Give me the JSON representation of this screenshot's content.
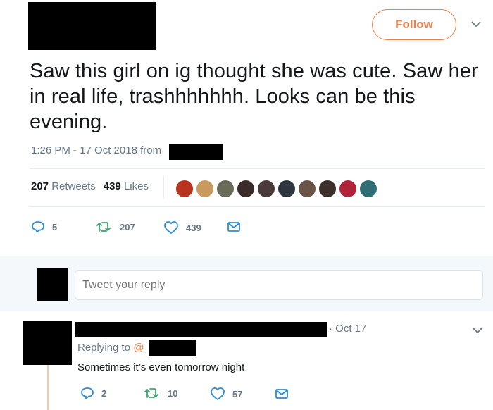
{
  "colors": {
    "accent": "#e8824a",
    "muted": "#657786",
    "text": "#14171a"
  },
  "header": {
    "follow_label": "Follow",
    "caret_icon": "chevron-down-icon"
  },
  "tweet": {
    "text": "Saw this girl on ig thought she was cute. Saw her in real life, trashhhhhhh. Looks can be this evening.",
    "timestamp": "1:26 PM - 17 Oct 2018 from"
  },
  "stats": {
    "retweets_count": "207",
    "retweets_label": "Retweets",
    "likes_count": "439",
    "likes_label": "Likes",
    "liker_avatar_colors": [
      "#b8341f",
      "#c99a5e",
      "#6b6b5a",
      "#3a2a2a",
      "#4a3a3a",
      "#2f3640",
      "#6a5548",
      "#3d2f2a",
      "#b0243a",
      "#2e6e74"
    ]
  },
  "actions": {
    "reply_count": "5",
    "retweet_count": "207",
    "like_count": "439"
  },
  "composer": {
    "placeholder": "Tweet your reply"
  },
  "reply": {
    "date": "· Oct 17",
    "replying_prefix": "Replying to ",
    "replying_handle": "@",
    "text": "Sometimes it’s even tomorrow night",
    "reply_count": "2",
    "retweet_count": "10",
    "like_count": "57"
  }
}
